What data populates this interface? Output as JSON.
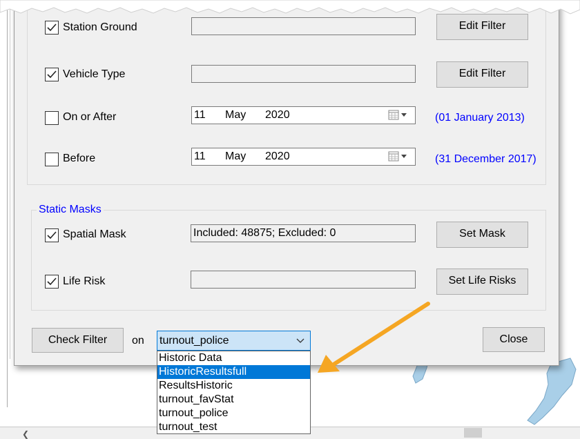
{
  "filters": {
    "station_ground": {
      "label": "Station Ground",
      "checked": true,
      "value": "",
      "button": "Edit Filter"
    },
    "vehicle_type": {
      "label": "Vehicle Type",
      "checked": true,
      "value": "",
      "button": "Edit Filter"
    },
    "on_or_after": {
      "label": "On or After",
      "checked": false,
      "day": "11",
      "month": "May",
      "year": "2020",
      "hint": "(01 January 2013)"
    },
    "before": {
      "label": "Before",
      "checked": false,
      "day": "11",
      "month": "May",
      "year": "2020",
      "hint": "(31 December 2017)"
    }
  },
  "static_masks": {
    "title": "Static Masks",
    "spatial_mask": {
      "label": "Spatial Mask",
      "checked": true,
      "value": "Included: 48875; Excluded: 0",
      "button": "Set Mask"
    },
    "life_risk": {
      "label": "Life Risk",
      "checked": true,
      "value": "",
      "button": "Set Life Risks"
    }
  },
  "footer": {
    "check_filter": "Check Filter",
    "on_label": "on",
    "selected": "turnout_police",
    "close": "Close"
  },
  "dropdown_options": [
    "Historic Data",
    "HistoricResultsfull",
    "ResultsHistoric",
    "turnout_favStat",
    "turnout_police",
    "turnout_test"
  ],
  "highlighted_option": "HistoricResultsfull",
  "colors": {
    "accent": "#0078d7",
    "hint_blue": "#0000ff",
    "annotation_arrow": "#f5a623",
    "map_fill": "#a9cfe8"
  }
}
